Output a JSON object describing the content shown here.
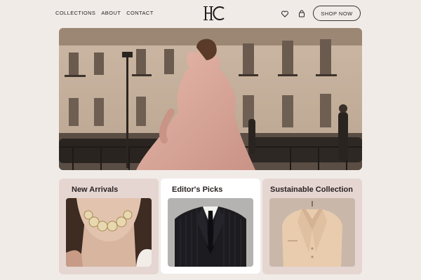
{
  "header": {
    "nav": [
      "COLLECTIONS",
      "ABOUT",
      "CONTACT"
    ],
    "logo_text": "HC",
    "shop_label": "SHOP NOW",
    "icons": [
      "heart-icon",
      "bag-icon"
    ]
  },
  "hero": {
    "image": "hero-photo-woman-pink-dress-paris-street"
  },
  "cards": [
    {
      "title": "New Arrivals",
      "image": "pearl-choker-necklace-photo"
    },
    {
      "title": "Editor's Picks",
      "image": "pinstripe-suit-tie-photo"
    },
    {
      "title": "Sustainable Collection",
      "image": "satin-blazer-hanger-photo"
    }
  ],
  "colors": {
    "background": "#f1ebe8",
    "card_tint": "#e5d6d2",
    "card_highlight": "#ffffff",
    "text": "#2a2222"
  }
}
